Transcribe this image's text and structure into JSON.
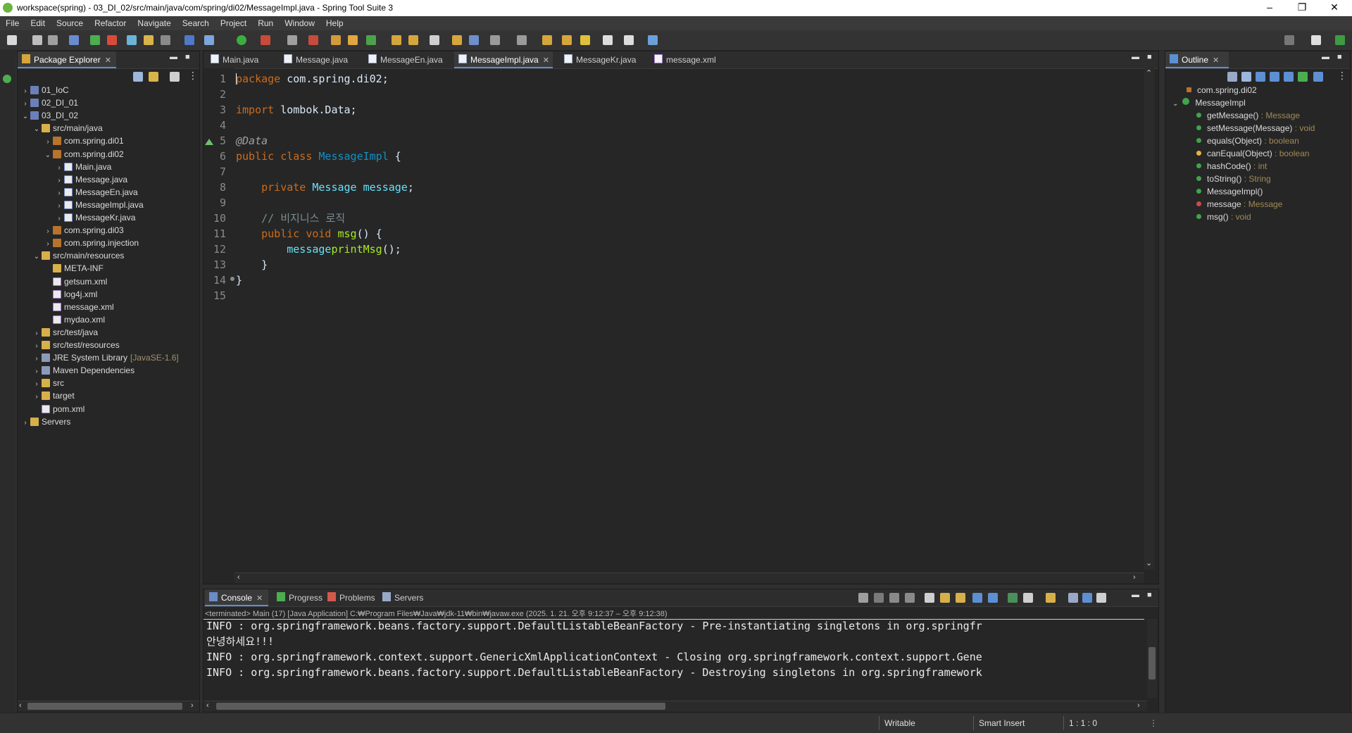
{
  "window": {
    "title": "workspace(spring) - 03_DI_02/src/main/java/com/spring/di02/MessageImpl.java - Spring Tool Suite 3",
    "minimize": "–",
    "restore": "❐",
    "close": "✕"
  },
  "menu": [
    "File",
    "Edit",
    "Source",
    "Refactor",
    "Navigate",
    "Search",
    "Project",
    "Run",
    "Window",
    "Help"
  ],
  "package_explorer": {
    "title": "Package Explorer",
    "items": [
      {
        "label": "01_IoC",
        "arrow": "›",
        "icon": "project-icon"
      },
      {
        "label": "02_DI_01",
        "arrow": "›",
        "icon": "project-icon"
      },
      {
        "label": "03_DI_02",
        "arrow": "⌄",
        "icon": "project-icon"
      },
      {
        "label": "src/main/java",
        "arrow": "⌄",
        "icon": "source-folder-icon"
      },
      {
        "label": "com.spring.di01",
        "arrow": "›",
        "icon": "package-icon"
      },
      {
        "label": "com.spring.di02",
        "arrow": "⌄",
        "icon": "package-icon"
      },
      {
        "label": "Main.java",
        "arrow": "›",
        "icon": "java-file-icon"
      },
      {
        "label": "Message.java",
        "arrow": "›",
        "icon": "java-file-icon"
      },
      {
        "label": "MessageEn.java",
        "arrow": "›",
        "icon": "java-file-icon"
      },
      {
        "label": "MessageImpl.java",
        "arrow": "›",
        "icon": "java-file-icon"
      },
      {
        "label": "MessageKr.java",
        "arrow": "›",
        "icon": "java-file-icon"
      },
      {
        "label": "com.spring.di03",
        "arrow": "›",
        "icon": "package-icon"
      },
      {
        "label": "com.spring.injection",
        "arrow": "›",
        "icon": "package-icon"
      },
      {
        "label": "src/main/resources",
        "arrow": "⌄",
        "icon": "source-folder-icon"
      },
      {
        "label": "META-INF",
        "arrow": "",
        "icon": "folder-icon"
      },
      {
        "label": "getsum.xml",
        "arrow": "",
        "icon": "xml-file-icon"
      },
      {
        "label": "log4j.xml",
        "arrow": "",
        "icon": "xml-file-icon"
      },
      {
        "label": "message.xml",
        "arrow": "",
        "icon": "xml-file-icon"
      },
      {
        "label": "mydao.xml",
        "arrow": "",
        "icon": "xml-file-icon"
      },
      {
        "label": "src/test/java",
        "arrow": "›",
        "icon": "source-folder-icon"
      },
      {
        "label": "src/test/resources",
        "arrow": "›",
        "icon": "source-folder-icon"
      },
      {
        "label": "JRE System Library",
        "suffix": "[JavaSE-1.6]",
        "arrow": "›",
        "icon": "library-icon"
      },
      {
        "label": "Maven Dependencies",
        "arrow": "›",
        "icon": "library-icon"
      },
      {
        "label": "src",
        "arrow": "›",
        "icon": "folder-icon"
      },
      {
        "label": "target",
        "arrow": "›",
        "icon": "folder-icon"
      },
      {
        "label": "pom.xml",
        "arrow": "",
        "icon": "xml-file-icon"
      },
      {
        "label": "Servers",
        "arrow": "›",
        "icon": "folder-icon"
      }
    ]
  },
  "editor": {
    "tabs": [
      {
        "label": "Main.java",
        "active": false
      },
      {
        "label": "Message.java",
        "active": false
      },
      {
        "label": "MessageEn.java",
        "active": false
      },
      {
        "label": "MessageImpl.java",
        "active": true
      },
      {
        "label": "MessageKr.java",
        "active": false
      },
      {
        "label": "message.xml",
        "active": false
      }
    ],
    "line_numbers": [
      "1",
      "2",
      "3",
      "4",
      "5",
      "6",
      "7",
      "8",
      "9",
      "10",
      "11",
      "12",
      "13",
      "14",
      "15"
    ],
    "code": {
      "l1_kw": "package",
      "l1_rest": " com.spring.di02;",
      "l3_kw": "import",
      "l3_rest": " lombok.Data;",
      "l5_ann": "@Data",
      "l6_kw1": "public",
      "l6_kw2": " class ",
      "l6_type": "MessageImpl",
      "l6_rest": " {",
      "l8_kw": "    private ",
      "l8_type": "Message",
      "l8_field": " message",
      ";": ";",
      "l10_cmt": "    // 비지니스 로직",
      "l11_kw": "    public void ",
      "l11_meth": "msg",
      "l11_rest": "() {",
      "l12_field": "        message",
      ".": ".",
      "l12_meth": "printMsg",
      "l12_rest": "();",
      "l13": "    }",
      "l14": "}"
    }
  },
  "console": {
    "tabs": [
      "Console",
      "Progress",
      "Problems",
      "Servers"
    ],
    "header": "<terminated> Main (17) [Java Application] C:₩Program Files₩Java₩jdk-11₩bin₩javaw.exe  (2025. 1. 21. 오후 9:12:37 – 오후 9:12:38)",
    "lines": [
      "INFO : org.springframework.beans.factory.support.DefaultListableBeanFactory - Pre-instantiating singletons in org.springfr",
      "안녕하세요!!!",
      "INFO : org.springframework.context.support.GenericXmlApplicationContext - Closing org.springframework.context.support.Gene",
      "INFO : org.springframework.beans.factory.support.DefaultListableBeanFactory - Destroying singletons in org.springframework"
    ]
  },
  "outline": {
    "title": "Outline",
    "package": "com.spring.di02",
    "class": "MessageImpl",
    "members": [
      {
        "name": "getMessage()",
        "type": " : Message",
        "color": "#3fa54a"
      },
      {
        "name": "setMessage(Message)",
        "type": " : void",
        "color": "#3fa54a"
      },
      {
        "name": "equals(Object)",
        "type": " : boolean",
        "color": "#3fa54a"
      },
      {
        "name": "canEqual(Object)",
        "type": " : boolean",
        "color": "#e8b33d"
      },
      {
        "name": "hashCode()",
        "type": " : int",
        "color": "#3fa54a"
      },
      {
        "name": "toString()",
        "type": " : String",
        "color": "#3fa54a"
      },
      {
        "name": "MessageImpl()",
        "type": "",
        "color": "#3fa54a"
      },
      {
        "name": "message",
        "type": " : Message",
        "color": "#d04a4a"
      },
      {
        "name": "msg()",
        "type": " : void",
        "color": "#3fa54a"
      }
    ]
  },
  "status": {
    "writable": "Writable",
    "insert_mode": "Smart Insert",
    "position": "1 : 1 : 0"
  },
  "colors": {
    "accent": "#5d8fd3",
    "background": "#262626",
    "keyword": "#cc6c1d",
    "type": "#1290c3"
  }
}
